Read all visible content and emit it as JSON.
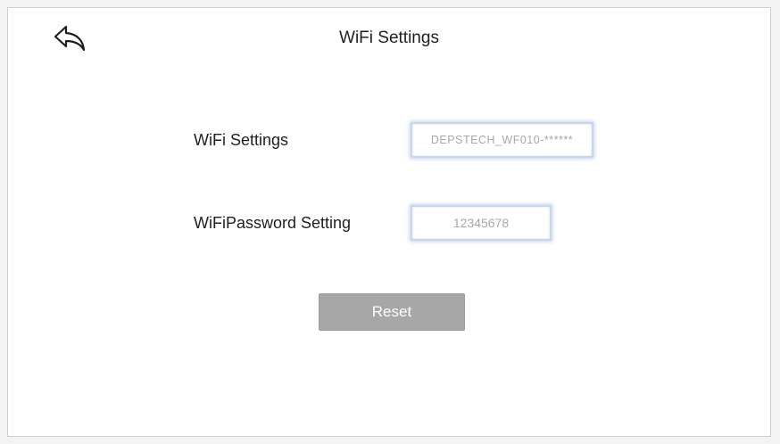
{
  "header": {
    "title": "WiFi Settings",
    "back_icon": "back-arrow-icon"
  },
  "form": {
    "ssid": {
      "label": "WiFi Settings",
      "value": "DEPSTECH_WF010-******"
    },
    "password": {
      "label": "WiFiPassword Setting",
      "value": "12345678"
    },
    "reset_label": "Reset"
  },
  "colors": {
    "reset_button": "#a7a7a7",
    "field_glow": "#c9d7ec",
    "field_text": "#a8a8a8"
  }
}
